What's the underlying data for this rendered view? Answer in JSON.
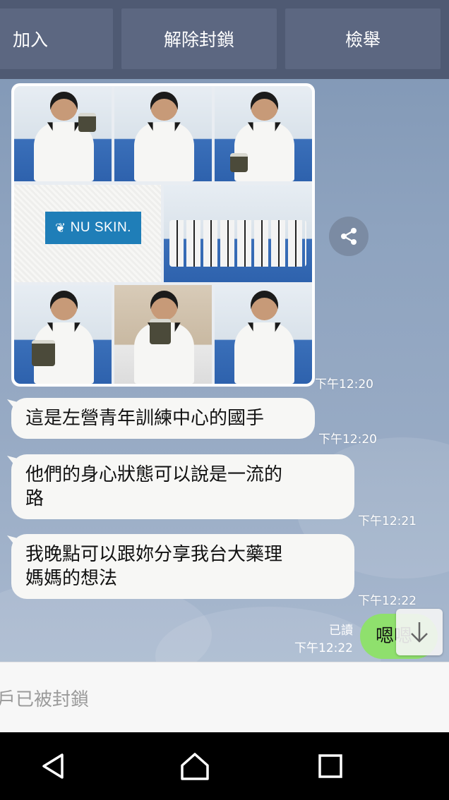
{
  "action_bar": {
    "join_label": "加入",
    "unblock_label": "解除封鎖",
    "report_label": "檢舉"
  },
  "image_message": {
    "logo_text": "NU SKIN.",
    "time": "下午12:20"
  },
  "messages": [
    {
      "text": "這是左營青年訓練中心的國手",
      "time": "下午12:20"
    },
    {
      "line1": "他們的身心狀態可以說是一流的",
      "line2": "路",
      "time": "下午12:21"
    },
    {
      "line1": "我晚點可以跟妳分享我台大藥理",
      "line2": "媽媽的想法",
      "time": "下午12:22"
    }
  ],
  "sent": {
    "text": "嗯嗯",
    "read_label": "已讀",
    "time": "下午12:22"
  },
  "input": {
    "blocked_text": "戶已被封鎖"
  },
  "icons": {
    "share": "share-icon",
    "scroll_down": "arrow-down-icon",
    "back": "nav-back-icon",
    "home": "nav-home-icon",
    "recents": "nav-recents-icon"
  },
  "colors": {
    "action_bar": "#4f5a73",
    "sent_bubble": "#8fe06d",
    "received_bubble": "#f7f7f5"
  }
}
